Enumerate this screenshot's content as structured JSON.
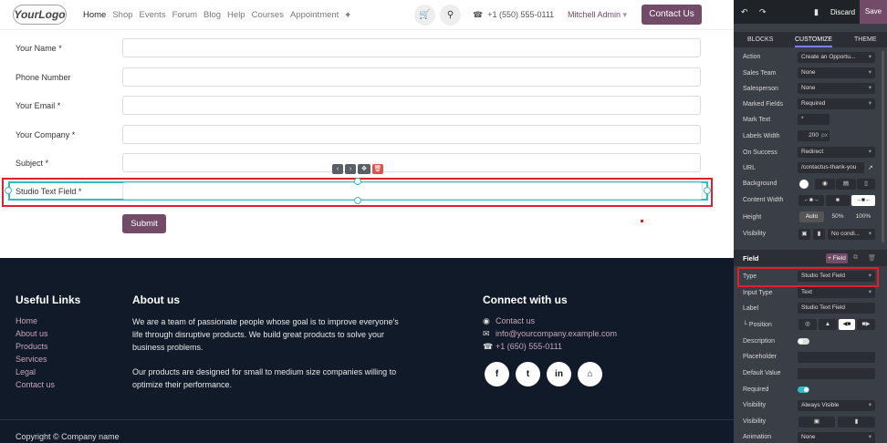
{
  "header": {
    "logo": "YourLogo",
    "nav": [
      "Home",
      "Shop",
      "Events",
      "Forum",
      "Blog",
      "Help",
      "Courses",
      "Appointment"
    ],
    "nav_plus": "+",
    "cart_icon": "cart-icon",
    "search_icon": "search-icon",
    "phone": "+1 (550) 555-0111",
    "user": "Mitchell Admin",
    "contact_button": "Contact Us"
  },
  "form": {
    "fields": [
      {
        "label": "Your Name",
        "required": "*"
      },
      {
        "label": "Phone Number",
        "required": ""
      },
      {
        "label": "Your Email",
        "required": "*"
      },
      {
        "label": "Your Company",
        "required": "*"
      },
      {
        "label": "Subject",
        "required": "*"
      },
      {
        "label": "Studio Text Field",
        "required": "*"
      }
    ],
    "submit": "Submit"
  },
  "footer": {
    "useful_links_title": "Useful Links",
    "links": [
      "Home",
      "About us",
      "Products",
      "Services",
      "Legal",
      "Contact us"
    ],
    "about_title": "About us",
    "about_p1": [
      "We are a team of passionate people whose goal is to improve everyone's",
      "life through disruptive products. We build great products to solve your",
      "business problems."
    ],
    "about_p2": [
      "Our products are designed for small to medium size companies willing to",
      "optimize their performance."
    ],
    "connect_title": "Connect with us",
    "contact": [
      "Contact us",
      "info@yourcompany.example.com",
      "+1 (650) 555-0111"
    ],
    "social": [
      "f",
      "t",
      "in",
      "⌂"
    ],
    "copyright": "Copyright © Company name"
  },
  "editor": {
    "discard": "Discard",
    "save": "Save",
    "tabs": [
      "BLOCKS",
      "CUSTOMIZE",
      "THEME"
    ],
    "rows": [
      {
        "label": "Action",
        "value": "Create an Opportu..."
      },
      {
        "label": "Sales Team",
        "value": "None"
      },
      {
        "label": "Salesperson",
        "value": "None"
      },
      {
        "label": "Marked Fields",
        "value": "Required"
      },
      {
        "label": "Mark Text",
        "value": "*"
      },
      {
        "label": "Labels Width",
        "value": "200",
        "unit": "px"
      },
      {
        "label": "On Success",
        "value": "Redirect"
      },
      {
        "label": "URL",
        "value": "/contactus-thank-you"
      },
      {
        "label": "Background",
        "value": ""
      },
      {
        "label": "Content Width",
        "value": ""
      },
      {
        "label": "Height",
        "options": [
          "Auto",
          "50%",
          "100%"
        ]
      },
      {
        "label": "Visibility",
        "value": "No condi..."
      }
    ],
    "field_section": "Field",
    "field_button": "+ Field",
    "field_rows": [
      {
        "label": "Type",
        "value": "Studio Text Field"
      },
      {
        "label": "Input Type",
        "value": "Text"
      },
      {
        "label": "Label",
        "value": "Studio Text Field"
      },
      {
        "label": "Position",
        "value": ""
      },
      {
        "label": "Description",
        "value": ""
      },
      {
        "label": "Placeholder",
        "value": ""
      },
      {
        "label": "Default Value",
        "value": ""
      },
      {
        "label": "Required",
        "value": ""
      },
      {
        "label": "Visibility",
        "value": "Always Visible"
      },
      {
        "label": "Visibility",
        "value": ""
      },
      {
        "label": "Animation",
        "value": "None"
      }
    ]
  }
}
